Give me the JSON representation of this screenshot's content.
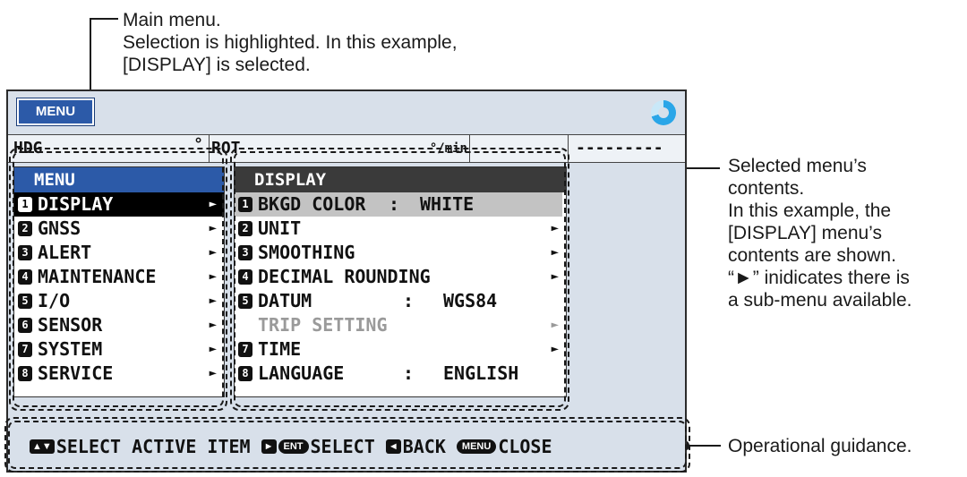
{
  "annotations": {
    "main_menu": [
      "Main menu.",
      "Selection is highlighted. In this example,",
      "[DISPLAY] is selected."
    ],
    "contents": [
      "Selected menu’s",
      "contents.",
      "In this example, the",
      "[DISPLAY] menu’s",
      "contents are shown.",
      "“►” inidicates there is",
      "a sub-menu available."
    ],
    "guidance": "Operational guidance."
  },
  "screen": {
    "menu_button": "MENU",
    "data_strip": [
      "HDG",
      "°",
      "ROT",
      "°/min",
      "---------"
    ],
    "main_menu": {
      "title": "MENU",
      "items": [
        {
          "num": "1",
          "label": "DISPLAY",
          "arrow": "►"
        },
        {
          "num": "2",
          "label": "GNSS",
          "arrow": "►"
        },
        {
          "num": "3",
          "label": "ALERT",
          "arrow": "►"
        },
        {
          "num": "4",
          "label": "MAINTENANCE",
          "arrow": "►"
        },
        {
          "num": "5",
          "label": "I/O",
          "arrow": "►"
        },
        {
          "num": "6",
          "label": "SENSOR",
          "arrow": "►"
        },
        {
          "num": "7",
          "label": "SYSTEM",
          "arrow": "►"
        },
        {
          "num": "8",
          "label": "SERVICE",
          "arrow": "►"
        }
      ]
    },
    "display_menu": {
      "title": "DISPLAY",
      "items": [
        {
          "num": "1",
          "label": "BKGD COLOR",
          "sep": ":",
          "value": "WHITE"
        },
        {
          "num": "2",
          "label": "UNIT",
          "arrow": "►"
        },
        {
          "num": "3",
          "label": "SMOOTHING",
          "arrow": "►"
        },
        {
          "num": "4",
          "label": "DECIMAL ROUNDING",
          "arrow": "►"
        },
        {
          "num": "5",
          "label": "DATUM",
          "sep": ":",
          "value": "WGS84"
        },
        {
          "label": "TRIP SETTING",
          "arrow": "►"
        },
        {
          "num": "7",
          "label": "TIME",
          "arrow": "►"
        },
        {
          "num": "8",
          "label": "LANGUAGE",
          "sep": ":",
          "value": "ENGLISH"
        }
      ]
    },
    "guidance": {
      "updown_key": "▲▼",
      "select_active": "SELECT ACTIVE ITEM",
      "right_key": "►",
      "ent_key": "ENT",
      "select": "SELECT",
      "left_key": "◄",
      "back": "BACK",
      "menu_key": "MENU",
      "close": "CLOSE"
    }
  },
  "colors": {
    "menu_header_bg": "#2c5aa8",
    "display_header_bg": "#3a3a3a",
    "screen_bg": "#d8e0ea",
    "selected_row_bg": "#000000",
    "highlight_row_bg": "#c3c3c3"
  }
}
